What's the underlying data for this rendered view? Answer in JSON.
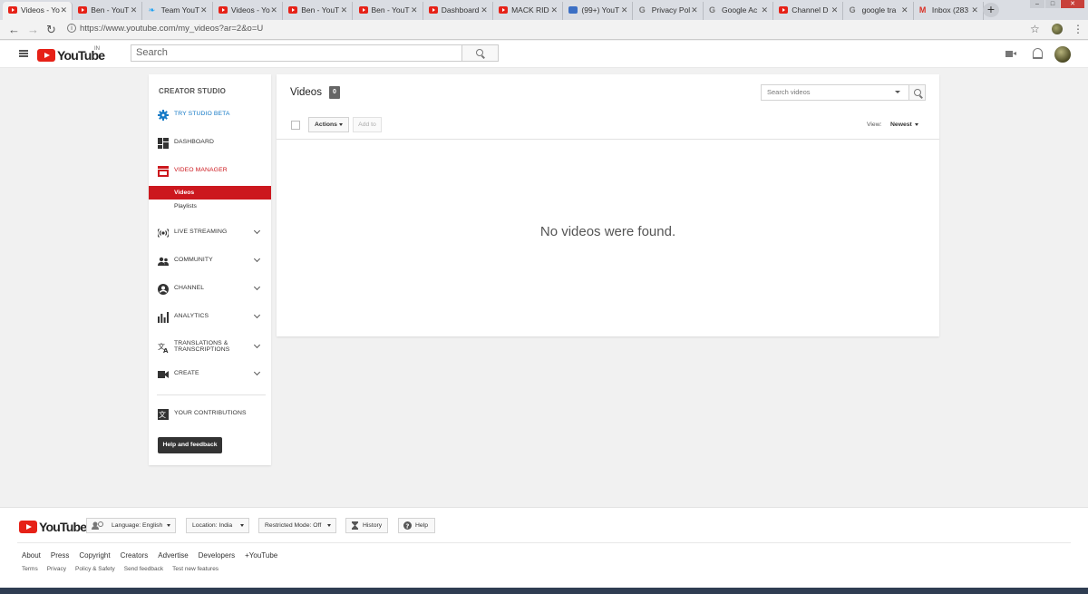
{
  "browser": {
    "tabs": [
      {
        "title": "Videos - Yo",
        "icon": "youtube",
        "active": true
      },
      {
        "title": "Ben - YouT",
        "icon": "youtube"
      },
      {
        "title": "Team YouT",
        "icon": "twitter"
      },
      {
        "title": "Videos - Yo",
        "icon": "youtube"
      },
      {
        "title": "Ben - YouT",
        "icon": "youtube"
      },
      {
        "title": "Ben - YouT",
        "icon": "youtube"
      },
      {
        "title": "Dashboard",
        "icon": "youtube"
      },
      {
        "title": "MACK RID",
        "icon": "youtube"
      },
      {
        "title": "(99+) YouT",
        "icon": "quora"
      },
      {
        "title": "Privacy Pol",
        "icon": "google"
      },
      {
        "title": "Google Ac",
        "icon": "google"
      },
      {
        "title": "Channel D",
        "icon": "youtube"
      },
      {
        "title": "google tra",
        "icon": "google"
      },
      {
        "title": "Inbox (283",
        "icon": "gmail"
      }
    ],
    "new_tab": "+",
    "url": "https://www.youtube.com/my_videos?ar=2&o=U"
  },
  "masthead": {
    "logo_text": "YouTube",
    "region": "IN",
    "search_placeholder": "Search"
  },
  "sidebar": {
    "title": "CREATOR STUDIO",
    "try_beta": "TRY STUDIO BETA",
    "dashboard": "DASHBOARD",
    "video_manager": "VIDEO MANAGER",
    "sub_videos": "Videos",
    "sub_playlists": "Playlists",
    "live_streaming": "LIVE STREAMING",
    "community": "COMMUNITY",
    "channel": "CHANNEL",
    "analytics": "ANALYTICS",
    "translations_1": "TRANSLATIONS &",
    "translations_2": "TRANSCRIPTIONS",
    "create": "CREATE",
    "contributions": "YOUR CONTRIBUTIONS",
    "help": "Help and feedback"
  },
  "main": {
    "title": "Videos",
    "count": "0",
    "search_placeholder": "Search videos",
    "actions": "Actions",
    "add_to": "Add to",
    "view_label": "View:",
    "view_value": "Newest",
    "empty_message": "No videos were found."
  },
  "footer": {
    "logo_text": "YouTube",
    "language": "Language: English",
    "location": "Location: India",
    "restricted": "Restricted Mode: Off",
    "history": "History",
    "help": "Help",
    "links": [
      "About",
      "Press",
      "Copyright",
      "Creators",
      "Advertise",
      "Developers",
      "+YouTube"
    ],
    "links2": [
      "Terms",
      "Privacy",
      "Policy & Safety",
      "Send feedback",
      "Test new features"
    ]
  },
  "colors": {
    "accent_red": "#cc181e",
    "beta_blue": "#167ac6"
  }
}
